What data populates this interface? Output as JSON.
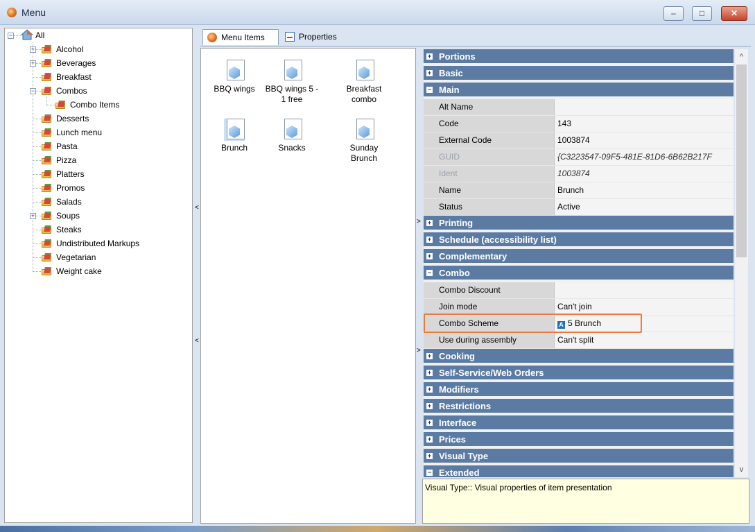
{
  "window": {
    "title": "Menu",
    "minimize": "–",
    "maximize": "□",
    "close": "✕"
  },
  "tree": {
    "root": "All",
    "items": [
      {
        "label": "Alcohol",
        "expander": "+"
      },
      {
        "label": "Beverages",
        "expander": "+"
      },
      {
        "label": "Breakfast",
        "expander": ""
      },
      {
        "label": "Combos",
        "expander": "−"
      },
      {
        "label": "Combo Items",
        "expander": "",
        "child": true
      },
      {
        "label": "Desserts",
        "expander": ""
      },
      {
        "label": "Lunch menu",
        "expander": ""
      },
      {
        "label": "Pasta",
        "expander": ""
      },
      {
        "label": "Pizza",
        "expander": ""
      },
      {
        "label": "Platters",
        "expander": ""
      },
      {
        "label": "Promos",
        "expander": ""
      },
      {
        "label": "Salads",
        "expander": ""
      },
      {
        "label": "Soups",
        "expander": "+"
      },
      {
        "label": "Steaks",
        "expander": ""
      },
      {
        "label": "Undistributed Markups",
        "expander": ""
      },
      {
        "label": "Vegetarian",
        "expander": ""
      },
      {
        "label": "Weight cake",
        "expander": ""
      }
    ]
  },
  "tabs": {
    "menu_items": "Menu Items",
    "properties": "Properties"
  },
  "menu_items": [
    {
      "label": "BBQ wings"
    },
    {
      "label": "BBQ wings 5 - 1 free"
    },
    {
      "label": "Breakfast combo"
    },
    {
      "label": "Brunch",
      "selected": true
    },
    {
      "label": "Snacks"
    },
    {
      "label": "Sunday Brunch"
    }
  ],
  "categories": {
    "portions": {
      "label": "Portions",
      "sign": "+"
    },
    "basic": {
      "label": "Basic",
      "sign": "+"
    },
    "main": {
      "label": "Main",
      "sign": "−"
    },
    "printing": {
      "label": "Printing",
      "sign": "+"
    },
    "schedule": {
      "label": "Schedule (accessibility list)",
      "sign": "+"
    },
    "complementary": {
      "label": "Complementary",
      "sign": "+"
    },
    "combo": {
      "label": "Combo",
      "sign": "−"
    },
    "cooking": {
      "label": "Cooking",
      "sign": "+"
    },
    "self_service": {
      "label": "Self-Service/Web Orders",
      "sign": "+"
    },
    "modifiers": {
      "label": "Modifiers",
      "sign": "+"
    },
    "restrictions": {
      "label": "Restrictions",
      "sign": "+"
    },
    "interface": {
      "label": "Interface",
      "sign": "+"
    },
    "prices": {
      "label": "Prices",
      "sign": "+"
    },
    "visual_type": {
      "label": "Visual Type",
      "sign": "+"
    },
    "extended": {
      "label": "Extended",
      "sign": "−"
    }
  },
  "main_props": [
    {
      "name": "Alt Name",
      "value": ""
    },
    {
      "name": "Code",
      "value": "143"
    },
    {
      "name": "External Code",
      "value": "1003874"
    },
    {
      "name": "GUID",
      "value": "{C3223547-09F5-481E-81D6-6B62B217F",
      "disabled": true
    },
    {
      "name": "Ident",
      "value": "1003874",
      "disabled": true
    },
    {
      "name": "Name",
      "value": "Brunch"
    },
    {
      "name": "Status",
      "value": "Active"
    }
  ],
  "combo_props": [
    {
      "name": "Combo Discount",
      "value": ""
    },
    {
      "name": "Join mode",
      "value": "Can't join"
    },
    {
      "name": "Combo Scheme",
      "value": "5 Brunch",
      "tag": "A"
    },
    {
      "name": "Use during assembly",
      "value": "Can't split"
    }
  ],
  "description": "Visual Type:: Visual properties of item presentation",
  "scroll": {
    "up": "^",
    "down": "v"
  },
  "grips": {
    "left": "<",
    "right": ">"
  }
}
